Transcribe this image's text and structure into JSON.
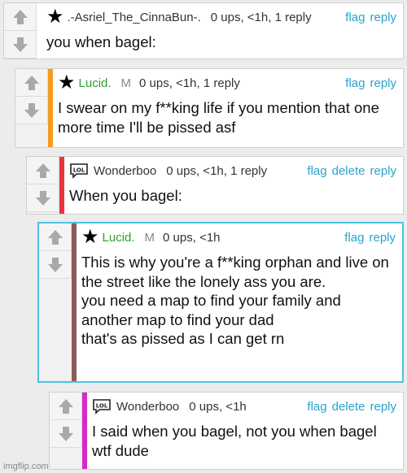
{
  "comments": [
    {
      "user": ".-Asriel_The_CinnaBun-.",
      "meta": "0 ups, <1h, 1 reply",
      "actions": [
        "flag",
        "reply"
      ],
      "text": "you when bagel:",
      "stripe": ""
    },
    {
      "user": "Lucid.",
      "mod": "M",
      "meta": "0 ups, <1h, 1 reply",
      "actions": [
        "flag",
        "reply"
      ],
      "text": "I swear on my f**king life if you mention that one more time I'll be pissed asf",
      "stripe": "#f49a20"
    },
    {
      "user": "Wonderboo",
      "meta": "0 ups, <1h, 1 reply",
      "actions": [
        "flag",
        "delete",
        "reply"
      ],
      "text": "When you bagel:",
      "stripe": "#e8363c"
    },
    {
      "user": "Lucid.",
      "mod": "M",
      "meta": "0 ups, <1h",
      "actions": [
        "flag",
        "reply"
      ],
      "text": "This is why you're a f**king orphan and live on the street like the lonely ass you are.\nyou need a map to find your family and another map to find your dad\nthat's as pissed as I can get rn",
      "stripe": "#8e5a5a"
    },
    {
      "user": "Wonderboo",
      "meta": "0 ups, <1h",
      "actions": [
        "flag",
        "delete",
        "reply"
      ],
      "text": "I said when you bagel, not you when bagel wtf dude",
      "stripe": "#d12cc6"
    }
  ],
  "icons": {
    "upvote": "up-arrow-icon",
    "downvote": "down-arrow-icon",
    "badge_star": "star-icon",
    "badge_lol": "lol-badge-icon"
  },
  "watermark": "imgflip.com"
}
